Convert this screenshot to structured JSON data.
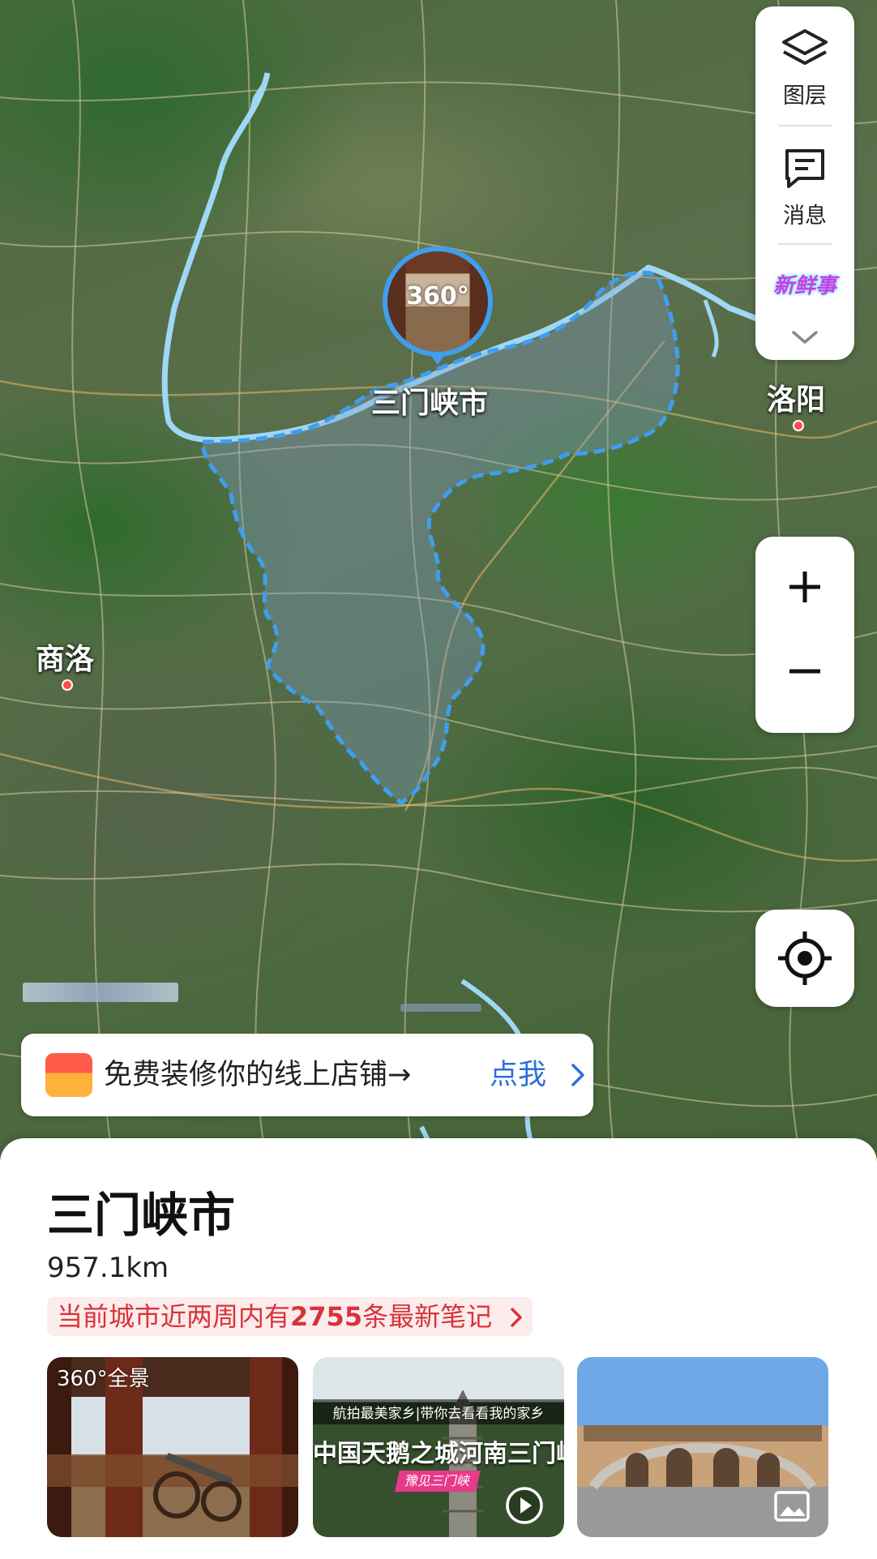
{
  "map": {
    "current_city_label": "三门峡市",
    "pano_badge": "360°",
    "cities": [
      {
        "name": "洛阳"
      },
      {
        "name": "商洛"
      }
    ]
  },
  "controls": {
    "layers_label": "图层",
    "messages_label": "消息",
    "new_badge": "新鲜事",
    "zoom_in": "+",
    "zoom_out": "−"
  },
  "promo": {
    "text": "免费装修你的线上店铺→",
    "link": "点我"
  },
  "place": {
    "title": "三门峡市",
    "distance": "957.1km",
    "notes_prefix": "当前城市近两周内有",
    "notes_count": "2755",
    "notes_suffix": "条最新笔记"
  },
  "thumbnails": [
    {
      "type": "panorama",
      "badge": "360°全景"
    },
    {
      "type": "video",
      "caption_top": "航拍最美家乡|带你去看看我的家乡",
      "caption_main": "中国天鹅之城河南三门峡",
      "tag": "豫见三门峡"
    },
    {
      "type": "photo"
    }
  ],
  "colors": {
    "boundary": "#3f9ef0",
    "link": "#2f6fd8",
    "notes_red": "#d8333a",
    "river": "#9ed8f5"
  }
}
